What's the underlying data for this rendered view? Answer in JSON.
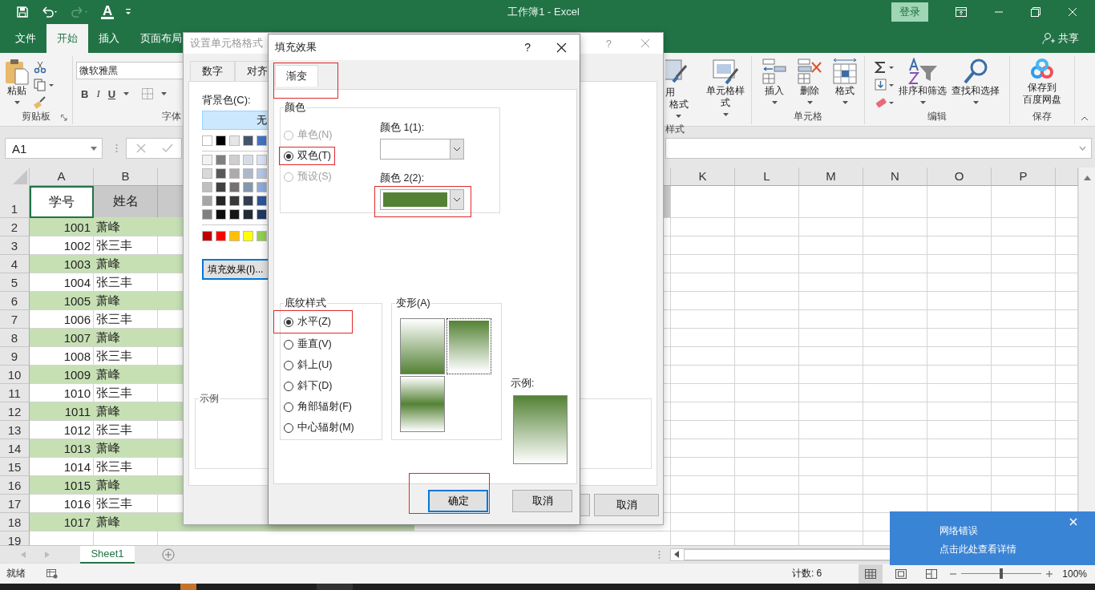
{
  "title_bar": {
    "font_color": "A",
    "title": "工作簿1 - Excel",
    "sign_in": "登录"
  },
  "ribbon_tabs": [
    {
      "label": "文件",
      "selected": false
    },
    {
      "label": "开始",
      "selected": true
    },
    {
      "label": "插入",
      "selected": false
    },
    {
      "label": "页面布局",
      "selected": false
    }
  ],
  "share": "共享",
  "clipboard": {
    "paste": "粘贴",
    "group": "剪贴板"
  },
  "font": {
    "name": "微软雅黑",
    "bold": "B",
    "italic": "I",
    "underline": "U",
    "group": "字体"
  },
  "styles": {
    "table_format_line1": "用",
    "table_format_line2": "格式",
    "cell_styles": "单元格样式",
    "group": "样式"
  },
  "cells_group": {
    "buttons": [
      "插入",
      "删除",
      "格式"
    ],
    "group": "单元格"
  },
  "editing": {
    "sort": "排序和筛选",
    "find": "查找和选择",
    "group": "编辑"
  },
  "save": {
    "line1": "保存到",
    "line2": "百度网盘",
    "group": "保存"
  },
  "name_box": "A1",
  "sheet": {
    "columns_left": [
      "A",
      "B"
    ],
    "columns_right": [
      "K",
      "L",
      "M",
      "N",
      "O",
      "P"
    ],
    "rows": [
      {
        "number": "1",
        "kind": "header",
        "cells": [
          {
            "text": "学号",
            "selected": true
          },
          {
            "text": "姓名",
            "selected": false
          }
        ]
      },
      {
        "number": "2",
        "kind": "data",
        "shaded": true,
        "cells": [
          {
            "text": "1001",
            "selected": false
          },
          {
            "text": "萧峰",
            "selected": false
          }
        ]
      },
      {
        "number": "3",
        "kind": "data",
        "shaded": false,
        "cells": [
          {
            "text": "1002",
            "selected": false
          },
          {
            "text": "张三丰",
            "selected": false
          }
        ]
      },
      {
        "number": "4",
        "kind": "data",
        "shaded": true,
        "cells": [
          {
            "text": "1003",
            "selected": false
          },
          {
            "text": "萧峰",
            "selected": false
          }
        ]
      },
      {
        "number": "5",
        "kind": "data",
        "shaded": false,
        "cells": [
          {
            "text": "1004",
            "selected": false
          },
          {
            "text": "张三丰",
            "selected": false
          }
        ]
      },
      {
        "number": "6",
        "kind": "data",
        "shaded": true,
        "cells": [
          {
            "text": "1005",
            "selected": false
          },
          {
            "text": "萧峰",
            "selected": false
          }
        ]
      },
      {
        "number": "7",
        "kind": "data",
        "shaded": false,
        "cells": [
          {
            "text": "1006",
            "selected": false
          },
          {
            "text": "张三丰",
            "selected": false
          }
        ]
      },
      {
        "number": "8",
        "kind": "data",
        "shaded": true,
        "cells": [
          {
            "text": "1007",
            "selected": false
          },
          {
            "text": "萧峰",
            "selected": false
          }
        ]
      },
      {
        "number": "9",
        "kind": "data",
        "shaded": false,
        "cells": [
          {
            "text": "1008",
            "selected": false
          },
          {
            "text": "张三丰",
            "selected": false
          }
        ]
      },
      {
        "number": "10",
        "kind": "data",
        "shaded": true,
        "cells": [
          {
            "text": "1009",
            "selected": false
          },
          {
            "text": "萧峰",
            "selected": false
          }
        ]
      },
      {
        "number": "11",
        "kind": "data",
        "shaded": false,
        "cells": [
          {
            "text": "1010",
            "selected": false
          },
          {
            "text": "张三丰",
            "selected": false
          }
        ]
      },
      {
        "number": "12",
        "kind": "data",
        "shaded": true,
        "cells": [
          {
            "text": "1011",
            "selected": false
          },
          {
            "text": "萧峰",
            "selected": false
          }
        ]
      },
      {
        "number": "13",
        "kind": "data",
        "shaded": false,
        "cells": [
          {
            "text": "1012",
            "selected": false
          },
          {
            "text": "张三丰",
            "selected": false
          }
        ]
      },
      {
        "number": "14",
        "kind": "data",
        "shaded": true,
        "cells": [
          {
            "text": "1013",
            "selected": false
          },
          {
            "text": "萧峰",
            "selected": false
          }
        ]
      },
      {
        "number": "15",
        "kind": "data",
        "shaded": false,
        "cells": [
          {
            "text": "1014",
            "selected": false
          },
          {
            "text": "张三丰",
            "selected": false
          }
        ]
      },
      {
        "number": "16",
        "kind": "data",
        "shaded": true,
        "cells": [
          {
            "text": "1015",
            "selected": false
          },
          {
            "text": "萧峰",
            "selected": false
          }
        ]
      },
      {
        "number": "17",
        "kind": "data",
        "shaded": false,
        "cells": [
          {
            "text": "1016",
            "selected": false
          },
          {
            "text": "张三丰",
            "selected": false
          }
        ]
      },
      {
        "number": "18",
        "kind": "data",
        "shaded": true,
        "cells": [
          {
            "text": "1017",
            "selected": false
          },
          {
            "text": "萧峰",
            "selected": false
          }
        ]
      },
      {
        "number": "19",
        "kind": "empty",
        "shaded": false
      }
    ]
  },
  "sheet_tabs": [
    {
      "label": "Sheet1",
      "selected": true
    }
  ],
  "status_bar": {
    "ready": "就绪",
    "count": "计数: 6",
    "views": [
      {
        "selected": true
      },
      {
        "selected": false
      },
      {
        "selected": false
      }
    ],
    "zoom": {
      "level": 0.5
    },
    "zoom_text": "100%"
  },
  "notification": {
    "title": "网络错误",
    "text": "点击此处查看详情"
  },
  "format_dialog": {
    "title": "设置单元格格式",
    "help": "?",
    "tabs": [
      {
        "label": "数字",
        "selected": false
      },
      {
        "label": "对齐",
        "selected": false
      }
    ],
    "background_label": "背景色(C):",
    "no_color": "无",
    "theme_colors": [
      {
        "color": "#ffffff"
      },
      {
        "color": "#000000"
      },
      {
        "color": "#e7e6e6"
      },
      {
        "color": "#44546a"
      },
      {
        "color": "#4472c4"
      }
    ],
    "shades": [
      [
        {
          "color": "#f2f2f2"
        },
        {
          "color": "#7f7f7f"
        },
        {
          "color": "#d0cece"
        },
        {
          "color": "#d6dce4"
        },
        {
          "color": "#d9e2f3"
        }
      ],
      [
        {
          "color": "#d9d9d9"
        },
        {
          "color": "#595959"
        },
        {
          "color": "#aeaaaa"
        },
        {
          "color": "#adb9ca"
        },
        {
          "color": "#b4c6e7"
        }
      ],
      [
        {
          "color": "#bfbfbf"
        },
        {
          "color": "#404040"
        },
        {
          "color": "#757171"
        },
        {
          "color": "#8497b0"
        },
        {
          "color": "#8eaadb"
        }
      ],
      [
        {
          "color": "#a6a6a6"
        },
        {
          "color": "#262626"
        },
        {
          "color": "#3a3838"
        },
        {
          "color": "#333f4f"
        },
        {
          "color": "#2f5496"
        }
      ],
      [
        {
          "color": "#808080"
        },
        {
          "color": "#0d0d0d"
        },
        {
          "color": "#171616"
        },
        {
          "color": "#222a35"
        },
        {
          "color": "#1f3864"
        }
      ]
    ],
    "standard_colors": [
      {
        "color": "#c00000"
      },
      {
        "color": "#ff0000"
      },
      {
        "color": "#ffc000"
      },
      {
        "color": "#ffff00"
      },
      {
        "color": "#92d050"
      }
    ],
    "fill_effects": "填充效果(I)...",
    "sample_label": "示例",
    "cancel": "取消"
  },
  "fill_dialog": {
    "title": "填充效果",
    "help": "?",
    "tabs": [
      {
        "label": "渐变",
        "selected": true,
        "highlighted": true
      }
    ],
    "colors_group": "颜色",
    "color_modes": [
      {
        "label": "单色(N)",
        "selected": false,
        "disabled": true,
        "highlighted": false
      },
      {
        "label": "双色(T)",
        "selected": true,
        "disabled": false,
        "highlighted": true
      },
      {
        "label": "预设(S)",
        "selected": false,
        "disabled": true,
        "highlighted": false
      }
    ],
    "color_pickers": [
      {
        "label": "颜色 1(1):",
        "color": "#ffffff",
        "highlighted": false
      },
      {
        "label": "颜色 2(2):",
        "color": "#548235",
        "highlighted": true
      }
    ],
    "shading_group": "底纹样式",
    "shading_styles": [
      {
        "label": "水平(Z)",
        "selected": true,
        "highlighted": true
      },
      {
        "label": "垂直(V)",
        "selected": false,
        "highlighted": false
      },
      {
        "label": "斜上(U)",
        "selected": false,
        "highlighted": false
      },
      {
        "label": "斜下(D)",
        "selected": false,
        "highlighted": false
      },
      {
        "label": "角部辐射(F)",
        "selected": false,
        "highlighted": false
      },
      {
        "label": "中心辐射(M)",
        "selected": false,
        "highlighted": false
      }
    ],
    "variants_group": "变形(A)",
    "variants": [
      {
        "kind": "light_to_dark",
        "selected": false
      },
      {
        "kind": "dark_to_light",
        "selected": true
      },
      {
        "kind": "band",
        "selected": false
      }
    ],
    "sample_label": "示例:",
    "buttons": [
      {
        "label": "确定",
        "default": true,
        "highlighted": true
      },
      {
        "label": "取消",
        "default": false,
        "highlighted": false
      }
    ]
  }
}
